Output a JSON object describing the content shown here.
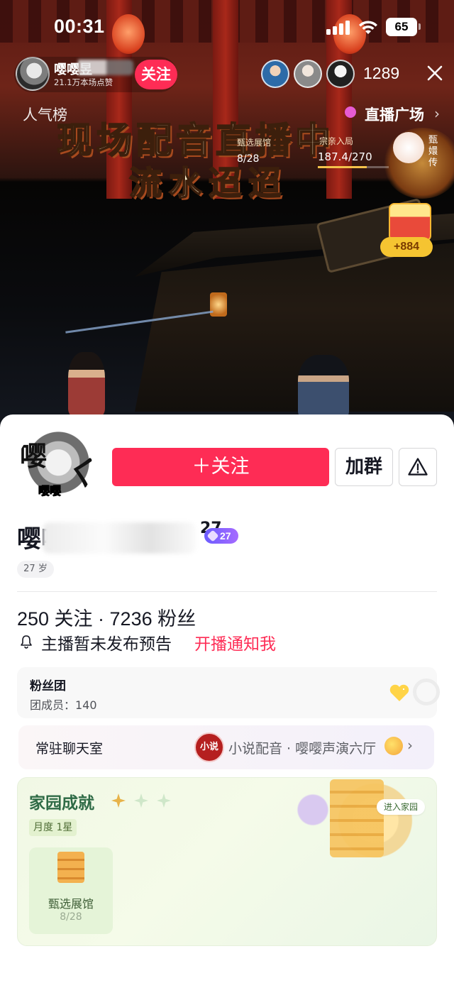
{
  "status_bar": {
    "time": "00:31",
    "battery": "65"
  },
  "live": {
    "host_name": "嘤嘤昱",
    "host_likes": "21.1万本场点赞",
    "follow_label": "关注",
    "viewer_count": "1289",
    "popularity_label": "人气榜",
    "live_square_label": "直播广场",
    "banner_line1": "现场配音直播中",
    "banner_line2": "流水迢迢",
    "hall_label": "甄选展馆",
    "hall_progress": "8/28",
    "rank_label": "宗亲入局",
    "rank_progress": "187.4/270",
    "rank_fill_ratio": 0.69,
    "side_label": "甄嬛传",
    "chest_amount": "+884"
  },
  "profile": {
    "follow_button": "＋关注",
    "join_group": "加群",
    "name": "嘤嘤",
    "name_suffix": "27",
    "level": "27",
    "age": "27 岁",
    "stats": "250 关注 · 7236 粉丝",
    "notice_text": "主播暂未发布预告",
    "notice_link": "开播通知我"
  },
  "fan_club": {
    "title": "粉丝团",
    "members": "团成员：140"
  },
  "chat_room": {
    "title": "常驻聊天室",
    "avatar_text": "小说",
    "room_name": "小说配音 · 嘤嘤声演六厅"
  },
  "home": {
    "title": "家园成就",
    "monthly_tag": "月度 1星",
    "enter_label": "进入家园",
    "tile_name": "甄选展馆",
    "tile_progress": "8/28"
  },
  "colors": {
    "accent": "#fe2c55",
    "home_green": "#2f6b46",
    "level_purple": "#6b5cff"
  },
  "icons": [
    "close-icon",
    "bell-icon",
    "warning-icon",
    "chevron-right-icon",
    "heart-icon",
    "wifi-icon",
    "signal-icon"
  ]
}
